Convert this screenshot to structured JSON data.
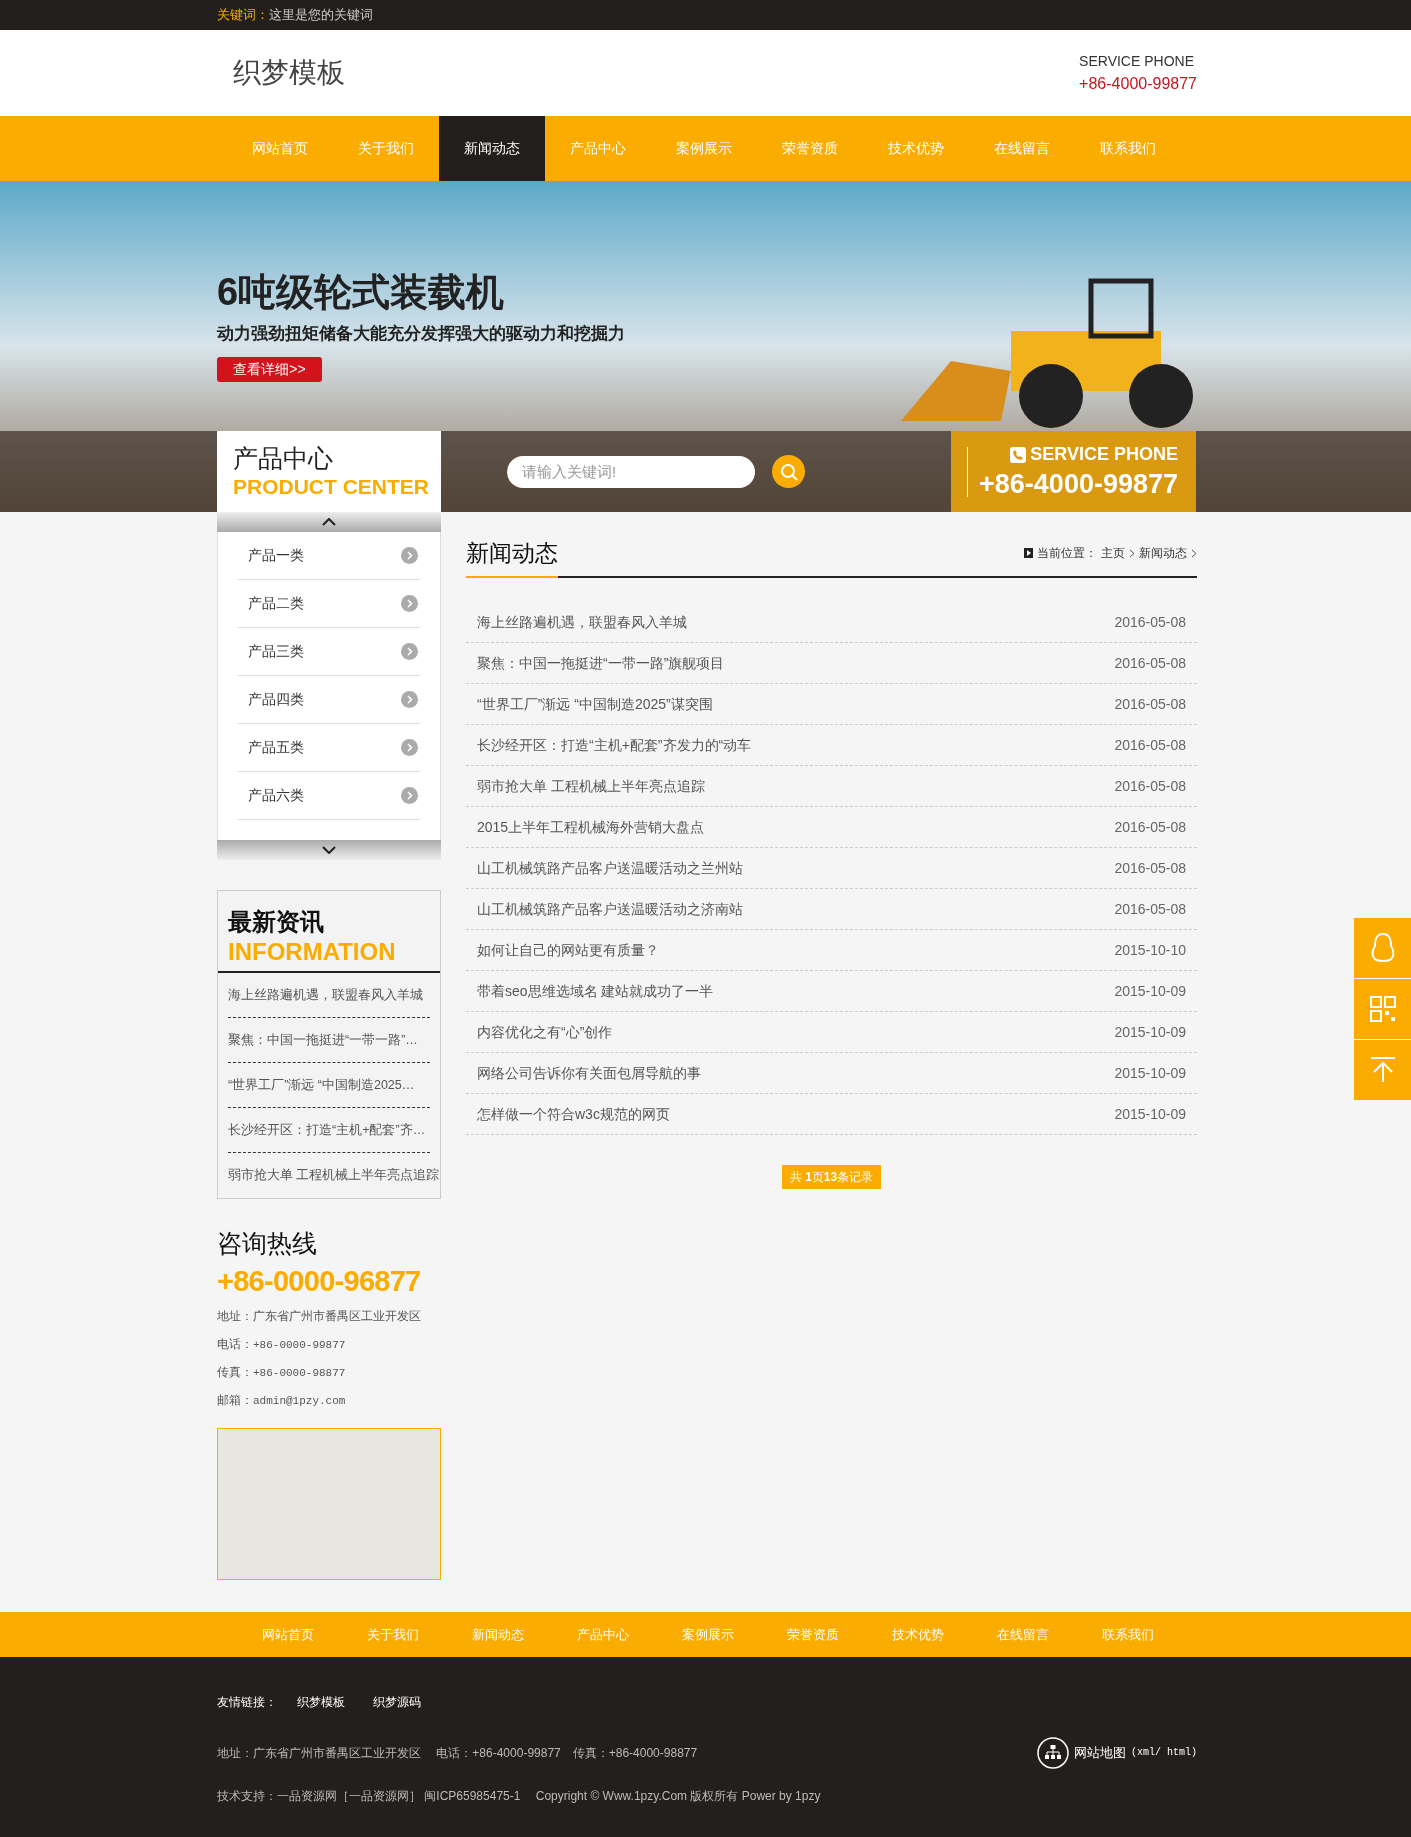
{
  "topbar": {
    "label": "关键词：",
    "text": "这里是您的关键词"
  },
  "header": {
    "logo": "织梦模板",
    "phone_label": "SERVICE PHONE",
    "phone": "+86-4000-99877"
  },
  "nav": [
    {
      "label": "网站首页",
      "selected": false
    },
    {
      "label": "关于我们",
      "selected": false
    },
    {
      "label": "新闻动态",
      "selected": true
    },
    {
      "label": "产品中心",
      "selected": false
    },
    {
      "label": "案例展示",
      "selected": false
    },
    {
      "label": "荣誉资质",
      "selected": false
    },
    {
      "label": "技术优势",
      "selected": false
    },
    {
      "label": "在线留言",
      "selected": false
    },
    {
      "label": "联系我们",
      "selected": false
    }
  ],
  "banner": {
    "title": "6吨级轮式装载机",
    "subtitle": "动力强劲扭矩储备大能充分发挥强大的驱动力和挖掘力",
    "button": "查看详细>>"
  },
  "search": {
    "placeholder": "请输入关键词!"
  },
  "service": {
    "label": "SERVICE PHONE",
    "phone": "+86-4000-99877"
  },
  "product_center": {
    "title": "产品中心",
    "subtitle": "PRODUCT CENTER",
    "items": [
      "产品一类",
      "产品二类",
      "产品三类",
      "产品四类",
      "产品五类",
      "产品六类"
    ]
  },
  "information": {
    "title": "最新资讯",
    "subtitle": "INFORMATION",
    "items": [
      "海上丝路遍机遇，联盟春风入羊城",
      "聚焦：中国一拖挺进“一带一路”…",
      "“世界工厂”渐远 “中国制造2025…",
      "长沙经开区：打造“主机+配套”齐…",
      "弱市抢大单 工程机械上半年亮点追踪"
    ]
  },
  "contact": {
    "title": "咨询热线",
    "phone": "+86-0000-96877",
    "lines": [
      {
        "label": "地址：",
        "value": "广东省广州市番禺区工业开发区",
        "kind": "text"
      },
      {
        "label": "电话：",
        "value": "+86-0000-99877",
        "kind": "mono"
      },
      {
        "label": "传真：",
        "value": "+86-0000-98877",
        "kind": "mono"
      },
      {
        "label": "邮箱：",
        "value": "admin@1pzy.com",
        "kind": "mono"
      }
    ]
  },
  "main": {
    "title": "新闻动态",
    "breadcrumb_label": "当前位置：",
    "breadcrumb": [
      "主页",
      "新闻动态"
    ]
  },
  "news": [
    {
      "title": "海上丝路遍机遇，联盟春风入羊城",
      "date": "2016-05-08"
    },
    {
      "title": "聚焦：中国一拖挺进“一带一路”旗舰项目",
      "date": "2016-05-08"
    },
    {
      "title": "“世界工厂”渐远 “中国制造2025”谋突围",
      "date": "2016-05-08"
    },
    {
      "title": "长沙经开区：打造“主机+配套”齐发力的“动车",
      "date": "2016-05-08"
    },
    {
      "title": "弱市抢大单 工程机械上半年亮点追踪",
      "date": "2016-05-08"
    },
    {
      "title": "2015上半年工程机械海外营销大盘点",
      "date": "2016-05-08"
    },
    {
      "title": "山工机械筑路产品客户送温暖活动之兰州站",
      "date": "2016-05-08"
    },
    {
      "title": "山工机械筑路产品客户送温暖活动之济南站",
      "date": "2016-05-08"
    },
    {
      "title": "如何让自己的网站更有质量？",
      "date": "2015-10-10"
    },
    {
      "title": "带着seo思维选域名 建站就成功了一半",
      "date": "2015-10-09"
    },
    {
      "title": "内容优化之有“心”创作",
      "date": "2015-10-09"
    },
    {
      "title": "网络公司告诉你有关面包屑导航的事",
      "date": "2015-10-09"
    },
    {
      "title": "怎样做一个符合w3c规范的网页",
      "date": "2015-10-09"
    }
  ],
  "pagination": "共 **1**页**13**条记录",
  "footer_nav": [
    "网站首页",
    "关于我们",
    "新闻动态",
    "产品中心",
    "案例展示",
    "荣誉资质",
    "技术优势",
    "在线留言",
    "联系我们"
  ],
  "footer": {
    "links_label": "友情链接：",
    "links": [
      "织梦模板",
      "织梦源码"
    ],
    "address": "地址：广东省广州市番禺区工业开发区　 电话：+86-4000-99877　传真：+86-4000-98877",
    "support": "技术支持：一品资源网［一品资源网］ 闽ICP65985475-1　 Copyright © Www.1pzy.Com 版权所有 Power by 1pzy",
    "sitemap": "网站地图",
    "sitemap_formats": "(xml/ html)"
  }
}
